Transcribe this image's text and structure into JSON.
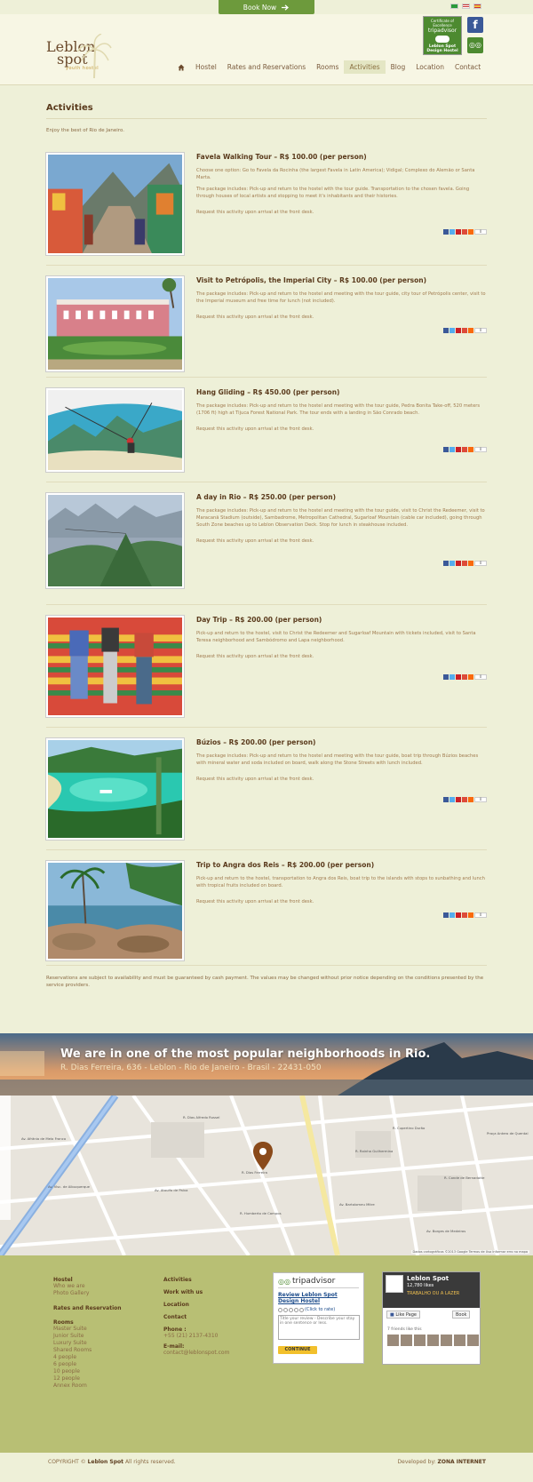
{
  "topbar": {
    "book_now": "Book Now"
  },
  "header": {
    "logo_line1": "Leblon",
    "logo_line2": "spot",
    "logo_tagline": "youth hostel",
    "award_line1": "Certificate of Excellence",
    "award_brand": "tripadvisor",
    "award_name": "Leblon Spot Design Hostel",
    "fb_letter": "f"
  },
  "nav": {
    "items": [
      "Hostel",
      "Rates and Reservations",
      "Rooms",
      "Activities",
      "Blog",
      "Location",
      "Contact"
    ],
    "active": "Activities"
  },
  "page": {
    "title": "Activities",
    "intro": "Enjoy the best of Rio de Janeiro.",
    "request_text": "Request this activity upon arrival at the front desk.",
    "share_count": "0",
    "footnote": "Reservations are subject to availability and must be guaranteed by cash payment. The values may be changed without prior notice depending on the conditions presented by the service providers."
  },
  "activities": [
    {
      "title": "Favela Walking Tour – R$ 100.00 (per person)",
      "p1": "Choose one option: Go to Favela da Rocinha (the largest Favela in Latin America); Vidigal; Complexo do Alemão or Santa Marta.",
      "p2": "The package includes: Pick-up and return to the hostel with the tour guide. Transportation to the chosen favela. Going through houses of local artists and stopping to meet it's inhabitants and their histories."
    },
    {
      "title": "Visit to Petrópolis, the Imperial City – R$ 100.00 (per person)",
      "p1": "The package includes: Pick-up and return to the hostel and meeting with the tour guide, city tour of Petrópolis center, visit to the Imperial museum and free time for lunch (not included).",
      "p2": ""
    },
    {
      "title": "Hang Gliding – R$ 450.00 (per person)",
      "p1": "The package includes: Pick-up and return to the hostel and meeting with the tour guide, Pedra Bonita Take-off, 520 meters (1706 ft) high at Tijuca Forest National Park. The tour ends with a landing in São Conrado beach.",
      "p2": ""
    },
    {
      "title": "A day in Rio – R$ 250.00 (per person)",
      "p1": "The package includes: Pick-up and return to the hostel and meeting with the tour guide, visit to Christ the Redeemer, visit to Maracanã Stadium (outside), Sambadrome, Metropolitan Cathedral, Sugarloaf Mountain (cable car included), going through South Zone beaches up to Leblon Observation Deck. Stop for lunch in steakhouse included.",
      "p2": ""
    },
    {
      "title": "Day Trip – R$ 200.00 (per person)",
      "p1": "Pick-up and return to the hostel, visit to Christ the Redeemer and Sugarloaf Mountain with tickets included, visit to Santa Teresa neighborhood and Sambódromo and Lapa neighborhood.",
      "p2": ""
    },
    {
      "title": "Búzios – R$ 200.00 (per person)",
      "p1": "The package includes: Pick-up and return to the hostel and meeting with the tour guide, boat trip through Búzios beaches with mineral water and soda included on board, walk along the Stone Streets with lunch included.",
      "p2": ""
    },
    {
      "title": "Trip to Angra dos Reis – R$ 200.00 (per person)",
      "p1": "Pick-up and return to the hostel, transportation to Angra dos Reis, boat trip to the islands with stops to sunbathing and lunch with tropical fruits included on board.",
      "p2": ""
    }
  ],
  "banner": {
    "title": "We are in one of the most popular neighborhoods in Rio.",
    "address": "R. Dias Ferreira, 636 - Leblon - Rio de Janeiro - Brasil - 22431-050"
  },
  "map": {
    "labels": [
      "R. Dias Ferreira",
      "Av. Afrânio de Melo Franco",
      "Av. Ataulfo de Paiva",
      "R. Humberto de Campos",
      "R. Rainha Guilhermina",
      "Av. Bartolomeu Mitre",
      "R. Dias Alfredo Russel",
      "Av. Visc. de Albuquerque",
      "R. Cupertino Durão",
      "R. Conde de Bernadotte",
      "Av. Borges de Medeiros",
      "Praça Antero de Quental"
    ],
    "footer": "Dados cartográficos ©2013 Google  Termos de Uso  Informar erro no mapa"
  },
  "footer": {
    "col1": {
      "hostel": "Hostel",
      "hostel_items": [
        "Who we are",
        "Photo Gallery"
      ],
      "rates": "Rates and Reservation",
      "rooms": "Rooms",
      "rooms_items": [
        "Master Suite",
        "Junior Suite",
        "Luxury Suite",
        "Shared Rooms",
        "4 people",
        "6 people",
        "10 people",
        "12 people",
        "Annex Room"
      ]
    },
    "col2": {
      "links": [
        "Activities",
        "Work with us",
        "Location",
        "Contact"
      ],
      "phone_label": "Phone :",
      "phone": "+55 (21) 2137-4310",
      "email_label": "E-mail:",
      "email": "contact@leblonspot.com"
    },
    "tripadvisor": {
      "brand": "tripadvisor",
      "review_title": "Review Leblon Spot Design Hostel",
      "rate_label": "(Click to rate)",
      "placeholder": "Title your review - Describe your stay in one sentence or less.",
      "button": "CONTINUE"
    },
    "facebook": {
      "page_name": "Leblon Spot",
      "likes": "12,780 likes",
      "promo": "TRABALHO OU A LAZER",
      "like_button": "Like Page",
      "book_button": "Book",
      "friends": "7 friends like this"
    }
  },
  "bottom": {
    "copyright_prefix": "COPYRIGHT ©",
    "copyright_brand": "Leblon Spot",
    "copyright_suffix": "All rights reserved.",
    "dev_prefix": "Developed by:",
    "dev_brand": "ZONA INTERNET"
  },
  "colors": {
    "background": "#eef0d8",
    "book_now": "#6d9a3c",
    "footer": "#b8bf74",
    "text": "#6b4a2c"
  }
}
